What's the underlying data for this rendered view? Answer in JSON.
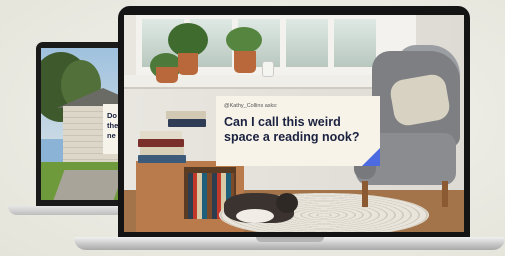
{
  "back_slide": {
    "handle": "",
    "question_lines": [
      "Do",
      "the",
      "ne"
    ]
  },
  "front_slide": {
    "handle": "@Kathy_Collins asks:",
    "question": "Can I call this weird space a reading nook?",
    "accent_color": "#4d6be0"
  }
}
